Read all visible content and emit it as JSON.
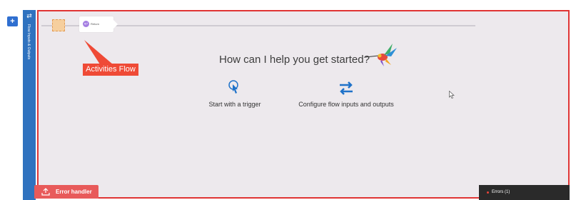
{
  "toolbar": {
    "add_label": "+"
  },
  "side_panel": {
    "label": "Flow Inputs & Outputs",
    "icon": "swap-icon"
  },
  "flow": {
    "trigger_placeholder": "trigger-placeholder",
    "return_step": {
      "label": "Return",
      "icon": "return-icon"
    }
  },
  "annotation": {
    "callout": "Activities Flow"
  },
  "main": {
    "heading": "How can I help you get started?",
    "options": [
      {
        "label": "Start with a trigger",
        "icon": "pointer-click-icon"
      },
      {
        "label": "Configure flow inputs and outputs",
        "icon": "swap-arrows-icon"
      }
    ]
  },
  "footer": {
    "error_handler_label": "Error handler",
    "errors_label": "Errors (1)"
  },
  "colors": {
    "accent_blue": "#2f72bf",
    "canvas_bg": "#ede9ed",
    "highlight_red": "#e03434",
    "error_handler": "#e85a5a",
    "errors_bar": "#2a2a2a"
  }
}
